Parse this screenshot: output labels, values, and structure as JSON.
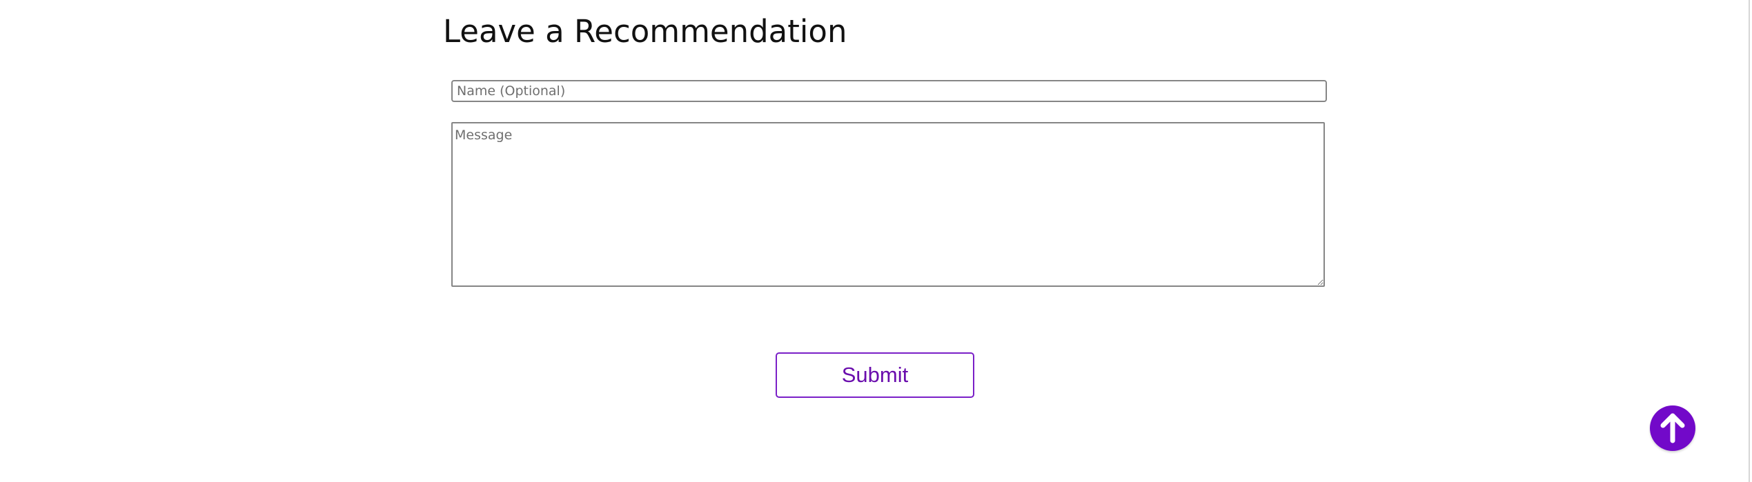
{
  "recommendation_form": {
    "title": "Leave a Recommendation",
    "name_placeholder": "Name (Optional)",
    "name_value": "",
    "message_placeholder": "Message",
    "message_value": "",
    "submit_label": "Submit"
  },
  "scroll_top": {
    "icon": "arrow-up-icon"
  },
  "colors": {
    "accent": "#7209c9",
    "button_text": "#6a0dad",
    "input_border": "#858585"
  }
}
